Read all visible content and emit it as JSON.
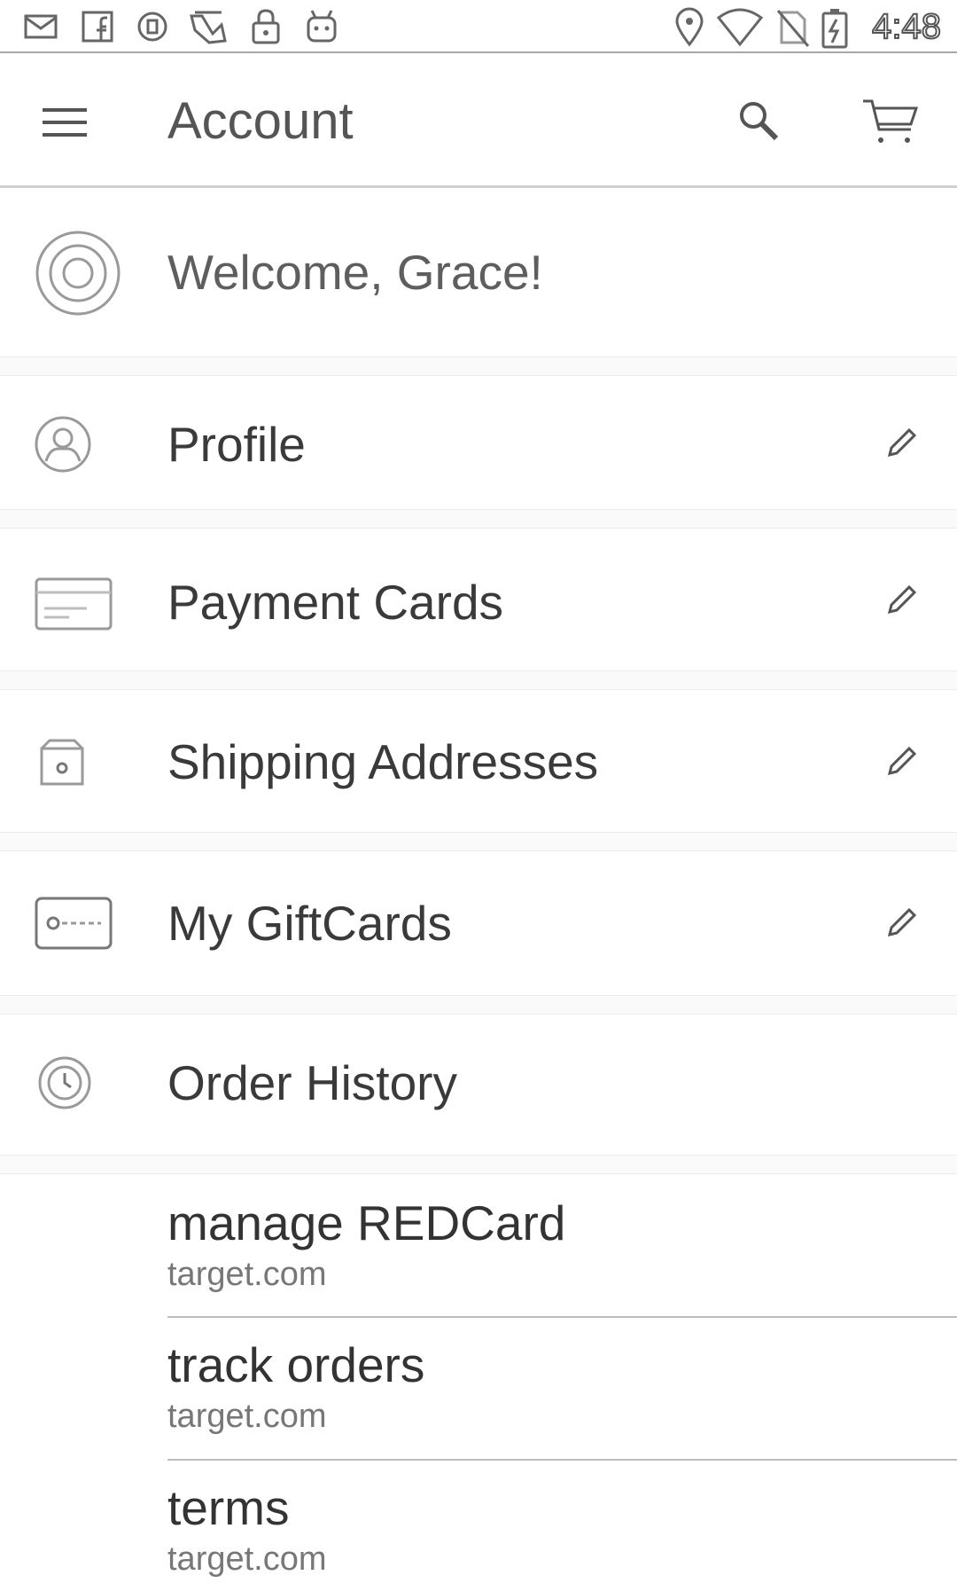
{
  "status_bar": {
    "time": "4:48",
    "icons": [
      "mail-icon",
      "facebook-icon",
      "circle-app-icon",
      "fav-app-icon",
      "lock-icon",
      "android-icon",
      "location-icon",
      "wifi-icon",
      "no-sim-icon",
      "battery-charging-icon"
    ]
  },
  "app_bar": {
    "title": "Account",
    "icons": [
      "menu-icon",
      "search-icon",
      "cart-icon"
    ]
  },
  "account": {
    "welcome": "Welcome, Grace!",
    "items": [
      {
        "label": "Profile",
        "icon": "profile-icon",
        "editable": true
      },
      {
        "label": "Payment Cards",
        "icon": "payment-card-icon",
        "editable": true
      },
      {
        "label": "Shipping Addresses",
        "icon": "shipping-box-icon",
        "editable": true
      },
      {
        "label": "My GiftCards",
        "icon": "gift-card-icon",
        "editable": true
      },
      {
        "label": "Order History",
        "icon": "order-history-icon",
        "editable": false
      }
    ]
  },
  "links": [
    {
      "title": "manage REDCard",
      "subtitle": "target.com"
    },
    {
      "title": "track orders",
      "subtitle": "target.com"
    },
    {
      "title": "terms",
      "subtitle": "target.com"
    }
  ],
  "colors": {
    "text": "#333333",
    "subtext": "#777777",
    "icon_stroke": "#888888",
    "divider": "#bdbdbd"
  }
}
